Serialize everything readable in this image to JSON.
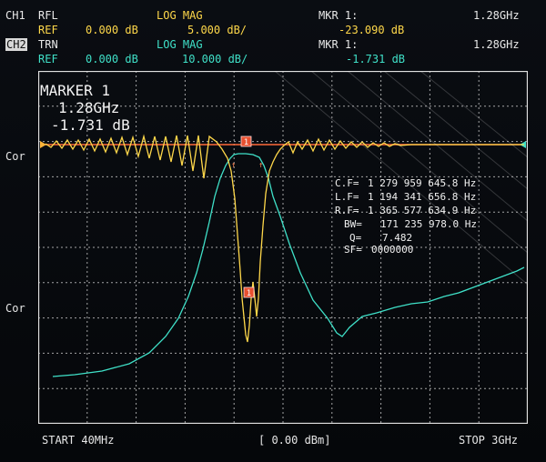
{
  "channels": [
    {
      "id": "CH1",
      "mode": "RFL",
      "format": "LOG MAG",
      "ref_label": "REF",
      "ref_value": "0.000 dB",
      "scale": "5.000 dB/",
      "mkr_label": "MKR 1:",
      "mkr_value": "-23.090 dB",
      "mkr_freq": "1.28GHz"
    },
    {
      "id": "CH2",
      "mode": "TRN",
      "format": "LOG MAG",
      "ref_label": "REF",
      "ref_value": "0.000 dB",
      "scale": "10.000 dB/",
      "mkr_label": "MKR 1:",
      "mkr_value": "-1.731 dB",
      "mkr_freq": "1.28GHz"
    }
  ],
  "top_fragment": "",
  "side_labels": {
    "upper": "Cor",
    "lower": "Cor"
  },
  "marker_box": {
    "title": "MARKER 1",
    "freq": "1.28GHz",
    "value": "-1.731 dB"
  },
  "marker_tag": "1",
  "stats": [
    {
      "label": "C.F=",
      "value": "1 279 959 645.8 Hz"
    },
    {
      "label": "L.F=",
      "value": "1 194 341 656.8 Hz"
    },
    {
      "label": "R.F=",
      "value": "1 365 577 634.9 Hz"
    },
    {
      "label": "BW=",
      "value": "171 235 978.0 Hz"
    },
    {
      "label": "Q=",
      "value": "7.482"
    },
    {
      "label": "SF=",
      "value": "0000000"
    }
  ],
  "footer": {
    "start": "START 40MHz",
    "power": "[ 0.00 dBm]",
    "stop": "STOP 3GHz"
  },
  "colors": {
    "trn_trace": "#3fe0c8",
    "rfl_trace": "#ffd84a",
    "ref_line": "#ff6a3a",
    "grid": "#d8d8d8",
    "text": "#e8e8e8"
  }
}
